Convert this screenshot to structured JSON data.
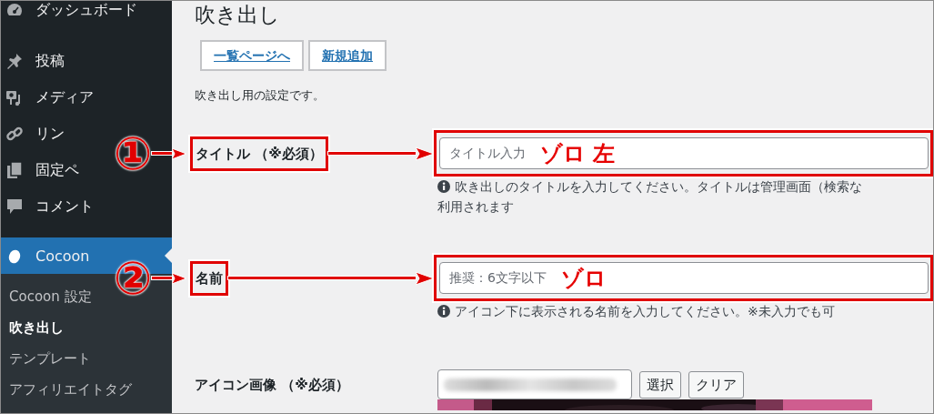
{
  "sidebar": {
    "items": [
      {
        "label": "ダッシュボード",
        "selected": false
      },
      {
        "label": "投稿",
        "selected": false
      },
      {
        "label": "メディア",
        "selected": false
      },
      {
        "label": "リン",
        "selected": false
      },
      {
        "label": "固定ペ",
        "selected": false
      },
      {
        "label": "コメント",
        "selected": false
      },
      {
        "label": "Cocoon",
        "selected": true
      }
    ],
    "submenu": [
      {
        "label": "Cocoon 設定",
        "selected": false
      },
      {
        "label": "吹き出し",
        "selected": true
      },
      {
        "label": "テンプレート",
        "selected": false
      },
      {
        "label": "アフィリエイトタグ",
        "selected": false
      }
    ]
  },
  "page": {
    "title": "吹き出し",
    "buttons": [
      "一覧ページへ",
      "新規追加"
    ],
    "description": "吹き出し用の設定です。"
  },
  "fields": [
    {
      "kind": "text",
      "label": "タイトル （※必須）",
      "placeholder": "タイトル入力",
      "help": [
        "吹き出しのタイトルを入力してください。タイトルは管理画面（検索な",
        "利用されます"
      ],
      "callout": {
        "number": "①",
        "note": "ゾロ 左"
      }
    },
    {
      "kind": "text",
      "label": "名前",
      "placeholder": "推奨：6文字以下",
      "help": [
        "アイコン下に表示される名前を入力してください。※未入力でも可"
      ],
      "callout": {
        "number": "②",
        "note": "ゾロ"
      }
    },
    {
      "label": "アイコン画像 （※必須）",
      "buttons": [
        "選択",
        "クリア"
      ]
    }
  ]
}
